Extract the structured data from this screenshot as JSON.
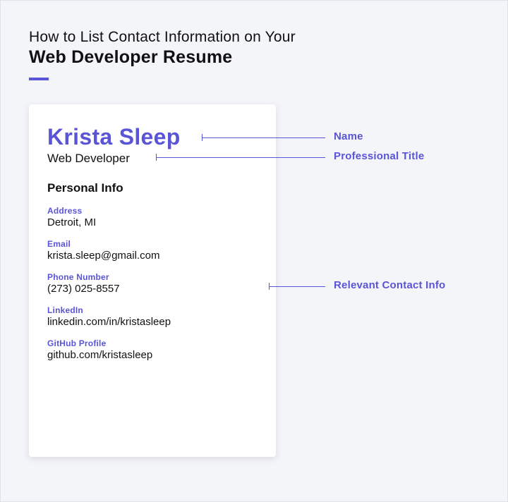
{
  "header": {
    "line1": "How to List Contact Information on Your",
    "line2": "Web Developer Resume"
  },
  "card": {
    "name": "Krista Sleep",
    "title": "Web Developer",
    "section": "Personal Info",
    "fields": {
      "address_label": "Address",
      "address_value": "Detroit, MI",
      "email_label": "Email",
      "email_value": "krista.sleep@gmail.com",
      "phone_label": "Phone Number",
      "phone_value": "(273) 025-8557",
      "linkedin_label": "LinkedIn",
      "linkedin_value": "linkedin.com/in/kristasleep",
      "github_label": "GitHub Profile",
      "github_value": "github.com/kristasleep"
    }
  },
  "annotations": {
    "name": "Name",
    "title": "Professional Title",
    "contact": "Relevant Contact Info"
  }
}
